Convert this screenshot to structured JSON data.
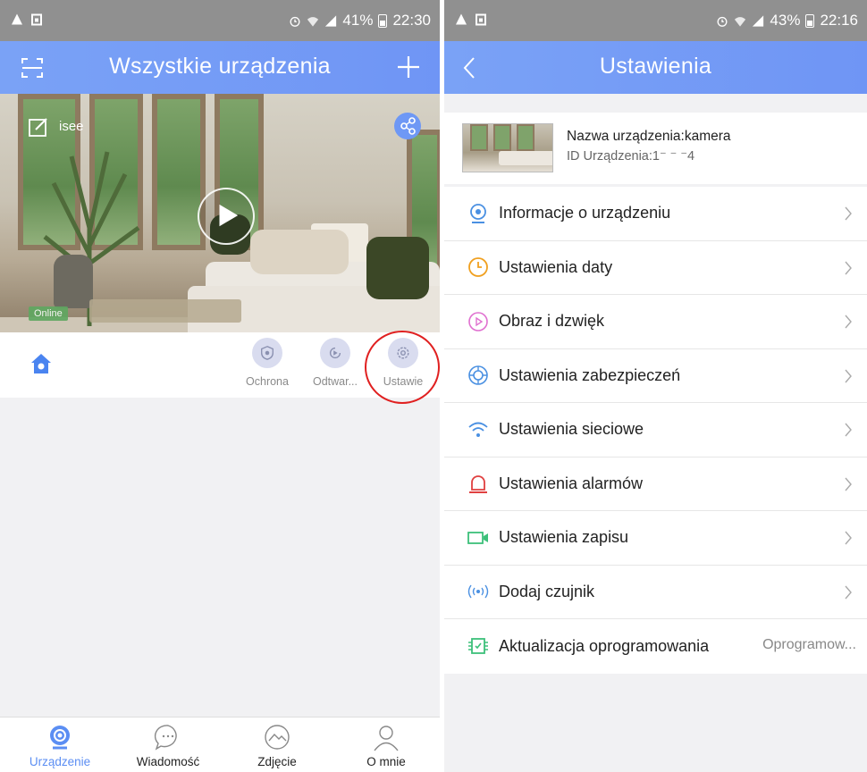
{
  "left": {
    "status": {
      "battery": "41%",
      "time": "22:30"
    },
    "header": {
      "title": "Wszystkie urządzenia"
    },
    "camera": {
      "name": "isee",
      "online": "Online"
    },
    "actions": [
      {
        "label": "Ochrona"
      },
      {
        "label": "Odtwar..."
      },
      {
        "label": "Ustawie"
      }
    ],
    "tabs": [
      {
        "label": "Urządzenie",
        "active": true
      },
      {
        "label": "Wiadomość"
      },
      {
        "label": "Zdjęcie"
      },
      {
        "label": "O mnie"
      }
    ],
    "colors": {
      "accent": "#6f95f5",
      "highlight_ring": "#e02020"
    }
  },
  "right": {
    "status": {
      "battery": "43%",
      "time": "22:16"
    },
    "header": {
      "title": "Ustawienia"
    },
    "device": {
      "name": "Nazwa urządzenia:kamera",
      "id": "ID Urządzenia:1⁻ ⁻ ⁻4"
    },
    "menu": [
      {
        "label": "Informacje o urządzeniu",
        "icon": "device-info-icon",
        "color": "#4a90e2"
      },
      {
        "label": "Ustawienia daty",
        "icon": "clock-icon",
        "color": "#f0a020"
      },
      {
        "label": "Obraz i dzwięk",
        "icon": "play-circle-icon",
        "color": "#e070d0"
      },
      {
        "label": "Ustawienia zabezpieczeń",
        "icon": "security-icon",
        "color": "#4a90e2"
      },
      {
        "label": "Ustawienia sieciowe",
        "icon": "wifi-icon",
        "color": "#4a90e2"
      },
      {
        "label": "Ustawienia alarmów",
        "icon": "alarm-icon",
        "color": "#e04040"
      },
      {
        "label": "Ustawienia zapisu",
        "icon": "record-icon",
        "color": "#3cc07a"
      },
      {
        "label": "Dodaj czujnik",
        "icon": "sensor-icon",
        "color": "#4a90e2"
      },
      {
        "label": "Aktualizacja oprogramowania",
        "icon": "firmware-icon",
        "color": "#3cc07a",
        "value": "Oprogramow..."
      }
    ]
  }
}
